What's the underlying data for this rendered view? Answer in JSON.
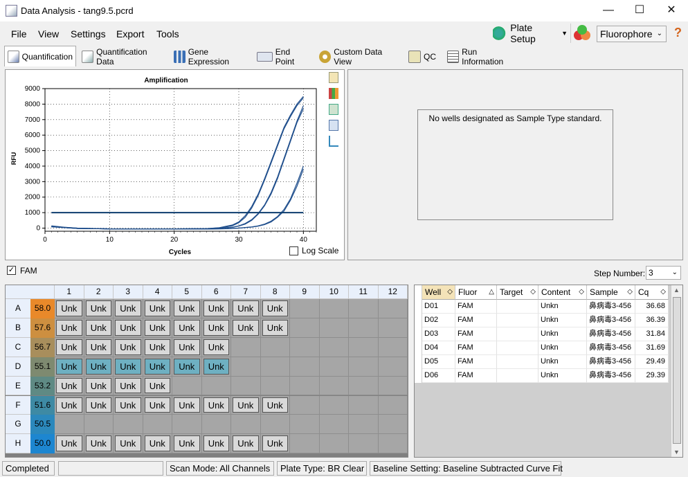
{
  "window": {
    "title": "Data Analysis - tang9.5.pcrd"
  },
  "menu": [
    "File",
    "View",
    "Settings",
    "Export",
    "Tools"
  ],
  "toolbar": {
    "plate_setup": "Plate Setup",
    "fluorophore": "Fluorophore",
    "help": "?"
  },
  "tabs": [
    "Quantification",
    "Quantification Data",
    "Gene Expression",
    "End Point",
    "Custom Data View",
    "QC",
    "Run Information"
  ],
  "chart_data": {
    "type": "line",
    "title": "Amplification",
    "xlabel": "Cycles",
    "ylabel": "RFU",
    "xlim": [
      0,
      42
    ],
    "ylim": [
      -200,
      9000
    ],
    "xticks": [
      0,
      10,
      20,
      30,
      40
    ],
    "yticks": [
      0,
      1000,
      2000,
      3000,
      4000,
      5000,
      6000,
      7000,
      8000,
      9000
    ],
    "threshold": 1000,
    "grid": true,
    "series": [
      {
        "x": [
          1,
          3,
          5,
          10,
          15,
          20,
          25,
          27,
          29,
          30,
          31,
          32,
          33,
          34,
          35,
          36,
          37,
          38,
          39,
          40
        ],
        "y": [
          100,
          50,
          0,
          -50,
          -50,
          -50,
          -30,
          30,
          200,
          400,
          800,
          1400,
          2200,
          3200,
          4300,
          5400,
          6500,
          7300,
          8000,
          8500
        ]
      },
      {
        "x": [
          1,
          3,
          5,
          10,
          15,
          20,
          25,
          27,
          29,
          30,
          31,
          32,
          33,
          34,
          35,
          36,
          37,
          38,
          39,
          40
        ],
        "y": [
          150,
          60,
          0,
          -50,
          -50,
          -50,
          -30,
          20,
          150,
          350,
          700,
          1300,
          2100,
          3100,
          4200,
          5300,
          6400,
          7200,
          7900,
          8400
        ]
      },
      {
        "x": [
          1,
          3,
          5,
          10,
          15,
          20,
          25,
          27,
          29,
          30,
          31,
          32,
          33,
          34,
          35,
          36,
          37,
          38,
          39,
          40
        ],
        "y": [
          80,
          30,
          -20,
          -50,
          -50,
          -50,
          -40,
          0,
          60,
          150,
          300,
          550,
          950,
          1500,
          2300,
          3300,
          4500,
          5700,
          6900,
          7900
        ]
      },
      {
        "x": [
          1,
          3,
          5,
          10,
          15,
          20,
          25,
          27,
          29,
          30,
          31,
          32,
          33,
          34,
          35,
          36,
          37,
          38,
          39,
          40
        ],
        "y": [
          100,
          40,
          -20,
          -50,
          -50,
          -50,
          -40,
          0,
          50,
          130,
          260,
          500,
          900,
          1450,
          2200,
          3200,
          4400,
          5600,
          6800,
          7700
        ]
      },
      {
        "x": [
          1,
          3,
          5,
          10,
          15,
          20,
          25,
          28,
          30,
          32,
          33,
          34,
          35,
          36,
          37,
          38,
          39,
          40
        ],
        "y": [
          120,
          40,
          -20,
          -50,
          -60,
          -60,
          -60,
          -40,
          0,
          80,
          150,
          260,
          450,
          750,
          1200,
          1900,
          2900,
          4000
        ]
      },
      {
        "x": [
          1,
          3,
          5,
          10,
          15,
          20,
          25,
          28,
          30,
          32,
          33,
          34,
          35,
          36,
          37,
          38,
          39,
          40
        ],
        "y": [
          90,
          30,
          -20,
          -50,
          -60,
          -60,
          -60,
          -40,
          0,
          70,
          130,
          230,
          400,
          700,
          1100,
          1800,
          2700,
          3800
        ]
      }
    ]
  },
  "log_scale_label": "Log Scale",
  "standard_message": "No wells designated as Sample Type standard.",
  "fam_label": "FAM",
  "step_number": {
    "label": "Step Number:",
    "value": "3"
  },
  "plate": {
    "columns": [
      "1",
      "2",
      "3",
      "4",
      "5",
      "6",
      "7",
      "8",
      "9",
      "10",
      "11",
      "12"
    ],
    "rows": [
      {
        "label": "A",
        "heat": "58.0",
        "color": "#e9892a",
        "wells": [
          "Unk",
          "Unk",
          "Unk",
          "Unk",
          "Unk",
          "Unk",
          "Unk",
          "Unk",
          "",
          "",
          "",
          ""
        ]
      },
      {
        "label": "B",
        "heat": "57.6",
        "color": "#cd8f40",
        "wells": [
          "Unk",
          "Unk",
          "Unk",
          "Unk",
          "Unk",
          "Unk",
          "Unk",
          "Unk",
          "",
          "",
          "",
          ""
        ]
      },
      {
        "label": "C",
        "heat": "56.7",
        "color": "#a88e5c",
        "wells": [
          "Unk",
          "Unk",
          "Unk",
          "Unk",
          "Unk",
          "Unk",
          "",
          "",
          "",
          "",
          "",
          ""
        ]
      },
      {
        "label": "D",
        "heat": "55.1",
        "color": "#7e8a70",
        "wells": [
          "Unk",
          "Unk",
          "Unk",
          "Unk",
          "Unk",
          "Unk",
          "",
          "",
          "",
          "",
          "",
          ""
        ],
        "selected": [
          0,
          1,
          2,
          3,
          4,
          5
        ]
      },
      {
        "label": "E",
        "heat": "53.2",
        "color": "#5f8a84",
        "wells": [
          "Unk",
          "Unk",
          "Unk",
          "Unk",
          "",
          "",
          "",
          "",
          "",
          "",
          "",
          ""
        ]
      },
      {
        "label": "F",
        "heat": "51.6",
        "color": "#3e8aa4",
        "wells": [
          "Unk",
          "Unk",
          "Unk",
          "Unk",
          "Unk",
          "Unk",
          "Unk",
          "Unk",
          "",
          "",
          "",
          ""
        ]
      },
      {
        "label": "G",
        "heat": "50.5",
        "color": "#2b88bc",
        "wells": [
          "",
          "",
          "",
          "",
          "",
          "",
          "",
          "",
          "",
          "",
          "",
          ""
        ]
      },
      {
        "label": "H",
        "heat": "50.0",
        "color": "#1d86d0",
        "wells": [
          "Unk",
          "Unk",
          "Unk",
          "Unk",
          "Unk",
          "Unk",
          "Unk",
          "Unk",
          "",
          "",
          "",
          ""
        ]
      }
    ]
  },
  "table": {
    "headers": [
      "Well",
      "Fluor",
      "Target",
      "Content",
      "Sample",
      "Cq"
    ],
    "rows": [
      [
        "D01",
        "FAM",
        "",
        "Unkn",
        "鼻病毒3-456",
        "36.68"
      ],
      [
        "D02",
        "FAM",
        "",
        "Unkn",
        "鼻病毒3-456",
        "36.39"
      ],
      [
        "D03",
        "FAM",
        "",
        "Unkn",
        "鼻病毒3-456",
        "31.84"
      ],
      [
        "D04",
        "FAM",
        "",
        "Unkn",
        "鼻病毒3-456",
        "31.69"
      ],
      [
        "D05",
        "FAM",
        "",
        "Unkn",
        "鼻病毒3-456",
        "29.49"
      ],
      [
        "D06",
        "FAM",
        "",
        "Unkn",
        "鼻病毒3-456",
        "29.39"
      ]
    ]
  },
  "status": [
    "Completed",
    "",
    "Scan Mode: All Channels",
    "Plate Type: BR Clear",
    "Baseline Setting: Baseline Subtracted Curve Fit"
  ]
}
